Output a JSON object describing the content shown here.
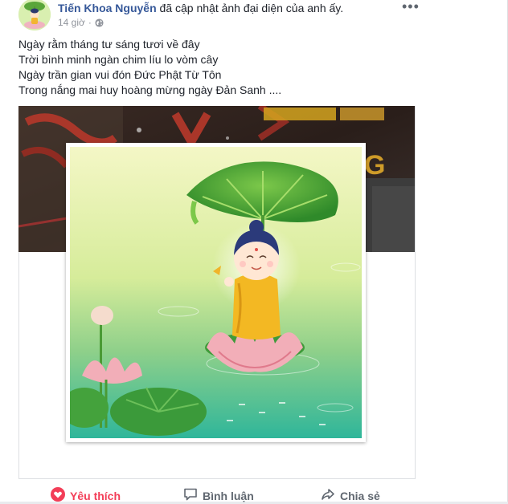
{
  "post": {
    "author": "Tiến Khoa Nguyễn",
    "action_text": "đã cập nhật ảnh đại diện của anh ấy.",
    "time": "14 giờ",
    "separator": "·",
    "more": "•••",
    "caption_lines": [
      "Ngày rằm tháng tư sáng tươi về đây",
      "Trời bình minh ngàn chim líu lo vòm cây",
      "Ngày trần gian vui đón Đức Phật Từ Tôn",
      "Trong nắng mai huy hoàng mừng ngày Đản Sanh ...."
    ]
  },
  "actions": {
    "like": "Yêu thích",
    "comment": "Bình luận",
    "share": "Chia sẻ"
  },
  "colors": {
    "link": "#365899",
    "like": "#f33e58",
    "muted": "#90949c"
  },
  "icons": [
    "globe-icon",
    "more-icon",
    "heart-icon",
    "comment-icon",
    "share-icon"
  ]
}
